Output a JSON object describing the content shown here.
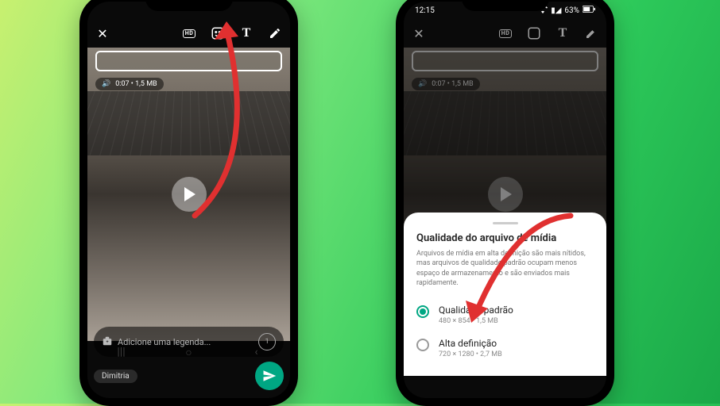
{
  "statusbar": {
    "time": "12:15",
    "battery": "63%"
  },
  "topbar": {
    "close": "✕",
    "hd": "HD",
    "sticker": "☺",
    "text": "T",
    "draw": "✎"
  },
  "media": {
    "meta": "0:07 • 1,5 MB",
    "speaker": "🔊"
  },
  "caption": {
    "camera": "📷",
    "placeholder": "Adicione uma legenda...",
    "view_once": "①"
  },
  "recipient": {
    "name": "Dimitria"
  },
  "sheet": {
    "title": "Qualidade do arquivo de mídia",
    "desc": "Arquivos de mídia em alta definição são mais nítidos, mas arquivos de qualidade padrão ocupam menos espaço de armazenamento e são enviados mais rapidamente.",
    "options": [
      {
        "label": "Qualidade padrão",
        "sub": "480 × 854 • 1,5 MB",
        "selected": true
      },
      {
        "label": "Alta definição",
        "sub": "720 × 1280 • 2,7 MB",
        "selected": false
      }
    ]
  },
  "nav": {
    "recents": "|||",
    "home": "○",
    "back": "‹"
  }
}
